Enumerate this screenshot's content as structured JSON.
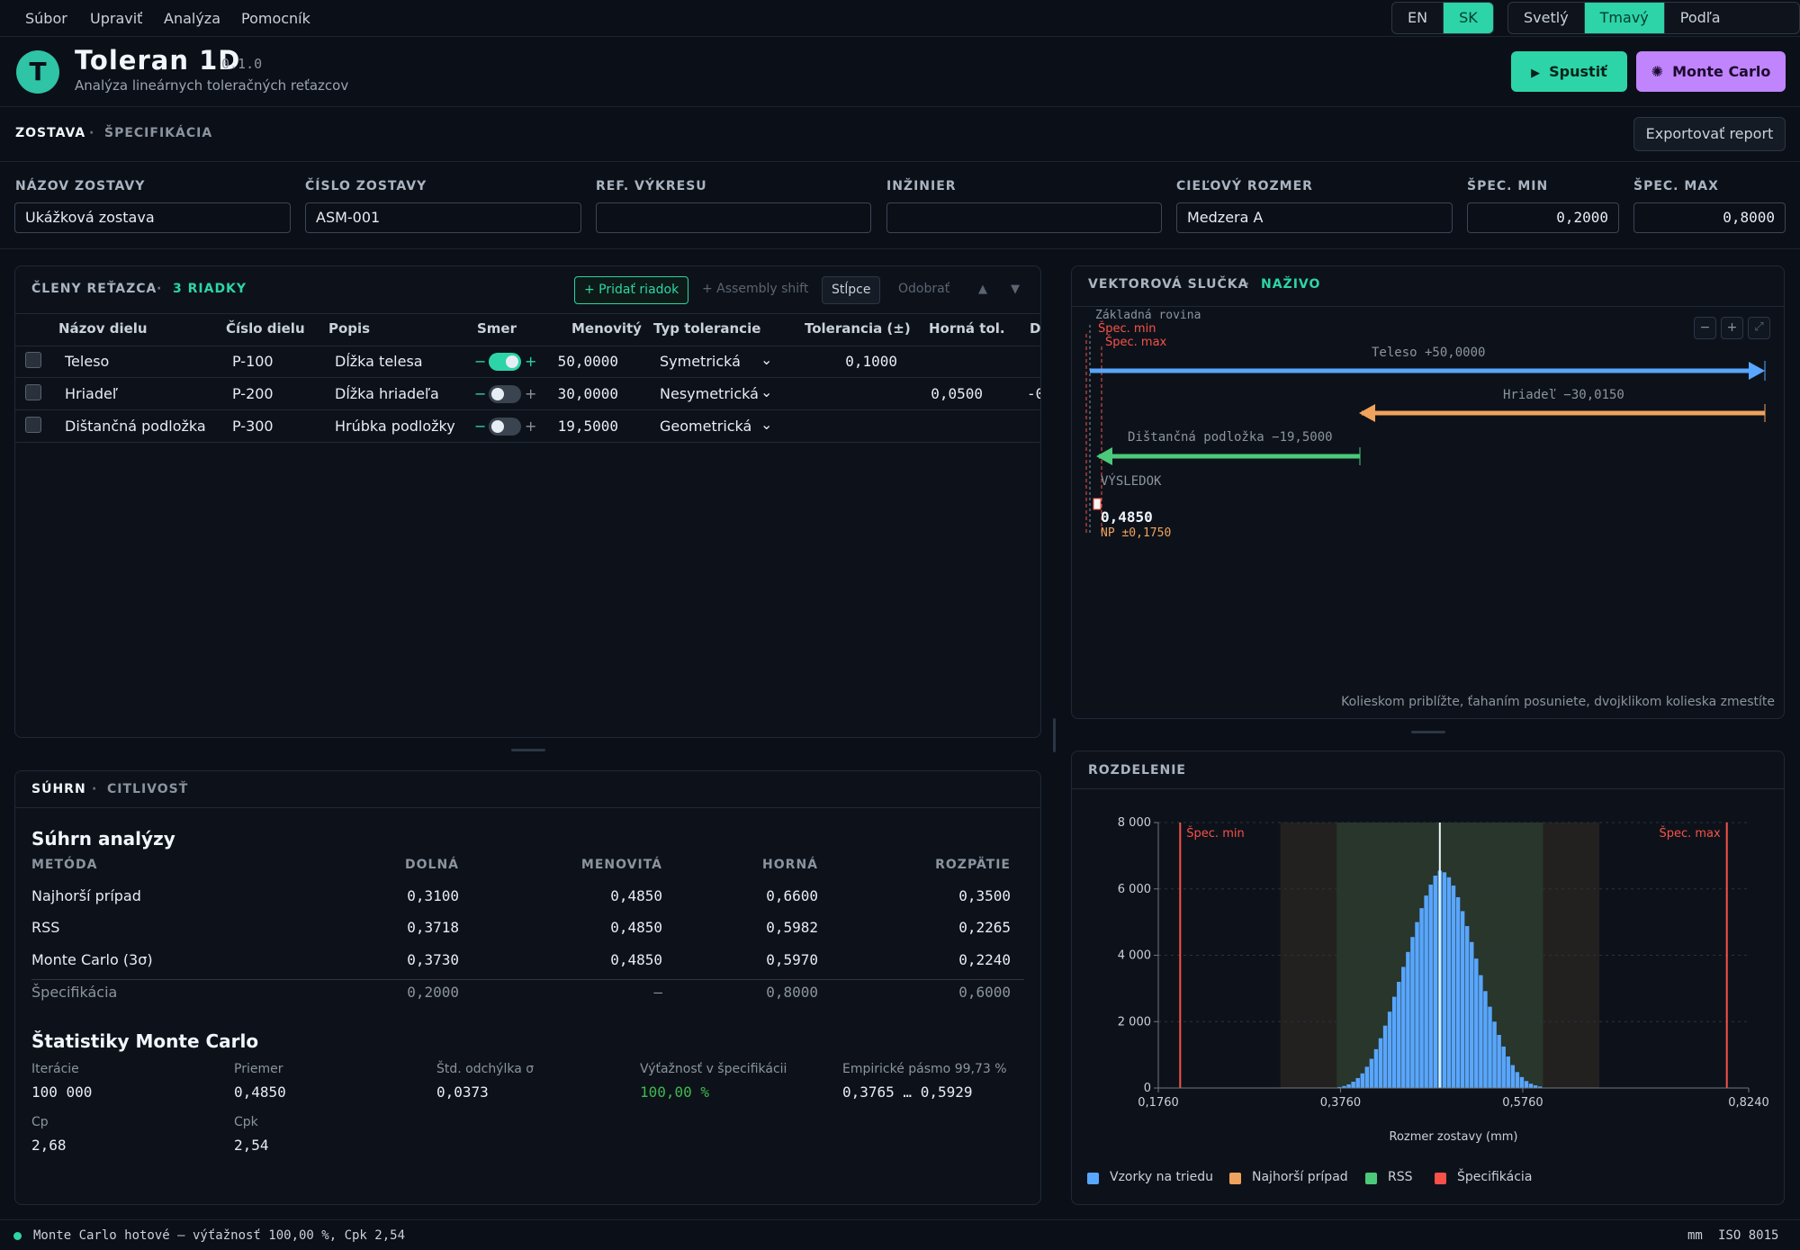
{
  "menu": {
    "items": [
      "Súbor",
      "Upraviť",
      "Analýza",
      "Pomocník"
    ]
  },
  "lang": {
    "options": [
      "EN",
      "SK"
    ],
    "selected": "SK"
  },
  "theme": {
    "options": [
      "Svetlý",
      "Tmavý",
      "Podľa systému"
    ],
    "selected": "Tmavý"
  },
  "app": {
    "logo_letter": "T",
    "name": "Toleran 1D",
    "version": "0.1.0",
    "subtitle": "Analýza lineárnych toleračných reťazcov",
    "run_label": "Spustiť",
    "mc_label": "Monte Carlo"
  },
  "nav": {
    "tabs": [
      "ZOSTAVA",
      "ŠPECIFIKÁCIA"
    ],
    "active": "ZOSTAVA",
    "sep": "·",
    "export_label": "Exportovať report"
  },
  "fields": {
    "name": {
      "label": "NÁZOV ZOSTAVY",
      "value": "Ukážková zostava"
    },
    "number": {
      "label": "ČÍSLO ZOSTAVY",
      "value": "ASM-001"
    },
    "drawing": {
      "label": "REF. VÝKRESU",
      "value": ""
    },
    "engineer": {
      "label": "INŽINIER",
      "value": ""
    },
    "target": {
      "label": "CIEĽOVÝ ROZMER",
      "value": "Medzera A"
    },
    "spec_min": {
      "label": "ŠPEC. MIN",
      "value": "0,2000"
    },
    "spec_max": {
      "label": "ŠPEC. MAX",
      "value": "0,8000"
    }
  },
  "chain": {
    "title": "ČLENY REŤAZCA",
    "count": "3 RIADKY",
    "sep": "·",
    "add_label": "+ Pridať riadok",
    "shift_label": "+ Assembly shift",
    "columns_label": "Stĺpce",
    "remove_label": "Odobrať",
    "up_icon": "▲",
    "down_icon": "▼",
    "headers": [
      "Názov dielu",
      "Číslo dielu",
      "Popis",
      "Smer",
      "Menovitý",
      "Typ tolerancie",
      "Tolerancia (±)",
      "Horná tol.",
      "D"
    ],
    "rows": [
      {
        "name": "Teleso",
        "part": "P-100",
        "desc": "Dĺžka telesa",
        "dir_on": true,
        "nominal": "50,0000",
        "type": "Symetrická",
        "tol": "0,1000",
        "upper": "",
        "lower": ""
      },
      {
        "name": "Hriadeľ",
        "part": "P-200",
        "desc": "Dĺžka hriadeľa",
        "dir_on": false,
        "nominal": "30,0000",
        "type": "Nesymetrická",
        "tol": "",
        "upper": "0,0500",
        "lower": "-0"
      },
      {
        "name": "Dištančná podložka",
        "part": "P-300",
        "desc": "Hrúbka podložky",
        "dir_on": false,
        "nominal": "19,5000",
        "type": "Geometrická",
        "tol": "",
        "upper": "",
        "lower": ""
      }
    ],
    "minus": "−",
    "plus": "+"
  },
  "vector": {
    "title": "VEKTOROVÁ SLUČKA",
    "live": "NAŽIVO",
    "sep": "·",
    "baseline": "Základná rovina",
    "spec_min": "Špec. min",
    "spec_max": "Špec. max",
    "vectors": [
      {
        "label": "Teleso +50,0000",
        "color": "#58a6ff"
      },
      {
        "label": "Hriadeľ −30,0150",
        "color": "#f0a35c"
      },
      {
        "label": "Dištančná podložka −19,5000",
        "color": "#4cc97a"
      }
    ],
    "result_label": "VÝSLEDOK",
    "result_value": "0,4850",
    "result_range": "NP ±0,1750",
    "hint": "Kolieskom priblížte, ťahaním posuniete, dvojklikom kolieska zmestíte",
    "zoom_out": "−",
    "zoom_in": "+",
    "fit": "⤢"
  },
  "summary": {
    "tabs": [
      "SÚHRN",
      "CITLIVOSŤ"
    ],
    "sep": "·",
    "title": "Súhrn analýzy",
    "headers": [
      "METÓDA",
      "DOLNÁ",
      "MENOVITÁ",
      "HORNÁ",
      "ROZPÄTIE"
    ],
    "rows": [
      [
        "Najhorší prípad",
        "0,3100",
        "0,4850",
        "0,6600",
        "0,3500"
      ],
      [
        "RSS",
        "0,3718",
        "0,4850",
        "0,5982",
        "0,2265"
      ],
      [
        "Monte Carlo (3σ)",
        "0,3730",
        "0,4850",
        "0,5970",
        "0,2240"
      ],
      [
        "Špecifikácia",
        "0,2000",
        "—",
        "0,8000",
        "0,6000"
      ]
    ],
    "mc_title": "Štatistiky Monte Carlo",
    "stats": [
      {
        "label": "Iterácie",
        "value": "100 000"
      },
      {
        "label": "Priemer",
        "value": "0,4850"
      },
      {
        "label": "Štd. odchýlka σ",
        "value": "0,0373"
      },
      {
        "label": "Výťažnosť v špecifikácii",
        "value": "100,00 %"
      },
      {
        "label": "Empirické pásmo 99,73 %",
        "value": "0,3765 … 0,5929"
      },
      {
        "label": "Cp",
        "value": "2,68"
      },
      {
        "label": "Cpk",
        "value": "2,54"
      }
    ]
  },
  "colors": {
    "accent": "#2dd4a7",
    "purple": "#c084fc",
    "bars": "#58a6ff",
    "worst": "#f0a35c",
    "rss": "#4cc97a",
    "spec": "#f85149"
  },
  "chart_data": {
    "type": "bar",
    "title": "ROZDELENIE",
    "xlabel": "Rozmer zostavy (mm)",
    "ylabel": "",
    "xlim": [
      0.176,
      0.824
    ],
    "ylim": [
      0,
      8000
    ],
    "xticks": [
      "0,1760",
      "0,3760",
      "0,5760",
      "0,8240"
    ],
    "xtick_values": [
      0.176,
      0.376,
      0.576,
      0.824
    ],
    "yticks": [
      "0",
      "2 000",
      "4 000",
      "6 000",
      "8 000"
    ],
    "ytick_values": [
      0,
      2000,
      4000,
      6000,
      8000
    ],
    "bin_width": 0.005,
    "bin_starts": [
      0.3725,
      0.3775,
      0.3825,
      0.3875,
      0.3925,
      0.3975,
      0.4025,
      0.4075,
      0.4125,
      0.4175,
      0.4225,
      0.4275,
      0.4325,
      0.4375,
      0.4425,
      0.4475,
      0.4525,
      0.4575,
      0.4625,
      0.4675,
      0.4725,
      0.4775,
      0.4825,
      0.4875,
      0.4925,
      0.4975,
      0.5025,
      0.5075,
      0.5125,
      0.5175,
      0.5225,
      0.5275,
      0.5325,
      0.5375,
      0.5425,
      0.5475,
      0.5525,
      0.5575,
      0.5625,
      0.5675,
      0.5725,
      0.5775,
      0.5825,
      0.5875,
      0.5925
    ],
    "values": [
      30,
      60,
      110,
      190,
      300,
      440,
      640,
      880,
      1170,
      1500,
      1880,
      2300,
      2750,
      3200,
      3650,
      4100,
      4550,
      5000,
      5420,
      5800,
      6130,
      6400,
      6550,
      6500,
      6350,
      6100,
      5750,
      5330,
      4880,
      4400,
      3900,
      3400,
      2920,
      2450,
      2000,
      1600,
      1250,
      950,
      690,
      480,
      330,
      210,
      130,
      80,
      45
    ],
    "series_name": "Vzorky na triedu",
    "worst_case": [
      0.31,
      0.66
    ],
    "rss": [
      0.3718,
      0.5982
    ],
    "spec": [
      0.2,
      0.8
    ],
    "mean": 0.485,
    "spec_min_label": "Špec. min",
    "spec_max_label": "Špec. max",
    "legend": [
      "Vzorky na triedu",
      "Najhorší prípad",
      "RSS",
      "Špecifikácia"
    ],
    "legend_placement": "bottom",
    "grid": true
  },
  "status": {
    "message": "Monte Carlo hotové — výťažnosť 100,00 %, Cpk 2,54",
    "units": "mm",
    "standard": "ISO 8015"
  }
}
